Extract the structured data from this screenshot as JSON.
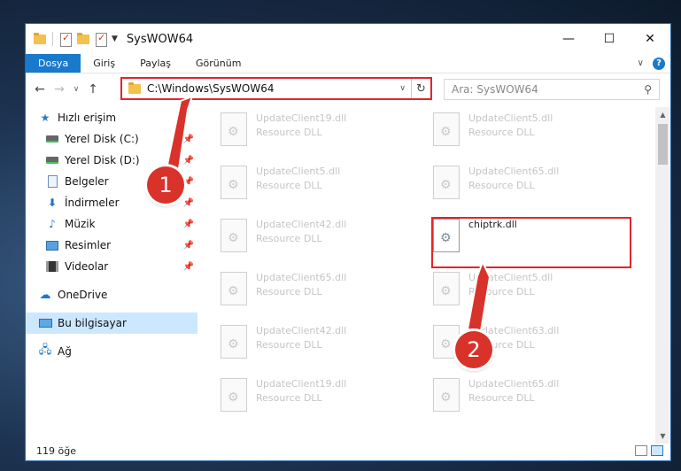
{
  "window": {
    "title": "SysWOW64",
    "controls": {
      "minimize": "—",
      "maximize": "☐",
      "close": "✕"
    }
  },
  "ribbon": {
    "tabs": [
      {
        "label": "Dosya",
        "active": true
      },
      {
        "label": "Giriş"
      },
      {
        "label": "Paylaş"
      },
      {
        "label": "Görünüm"
      }
    ],
    "help": "?"
  },
  "address": {
    "path": "C:\\Windows\\SysWOW64"
  },
  "search": {
    "placeholder": "Ara: SysWOW64"
  },
  "sidebar": {
    "quick_access": "Hızlı erişim",
    "items": [
      {
        "label": "Yerel Disk (C:)"
      },
      {
        "label": "Yerel Disk (D:)"
      },
      {
        "label": "Belgeler"
      },
      {
        "label": "İndirmeler"
      },
      {
        "label": "Müzik"
      },
      {
        "label": "Resimler"
      },
      {
        "label": "Videolar"
      }
    ],
    "onedrive": "OneDrive",
    "this_pc": "Bu bilgisayar",
    "network": "Ağ"
  },
  "files": [
    {
      "name": "UpdateClient19.dll",
      "type": "Resource DLL"
    },
    {
      "name": "UpdateClient5.dll",
      "type": "Resource DLL"
    },
    {
      "name": "UpdateClient5.dll",
      "type": "Resource DLL"
    },
    {
      "name": "UpdateClient65.dll",
      "type": "Resource DLL"
    },
    {
      "name": "UpdateClient42.dll",
      "type": "Resource DLL"
    },
    {
      "name": "chiptrk.dll",
      "type": ""
    },
    {
      "name": "UpdateClient65.dll",
      "type": "Resource DLL"
    },
    {
      "name": "UpdateClient5.dll",
      "type": "Resource DLL"
    },
    {
      "name": "UpdateClient42.dll",
      "type": "Resource DLL"
    },
    {
      "name": "UpdateClient63.dll",
      "type": "Resource DLL"
    },
    {
      "name": "UpdateClient19.dll",
      "type": "Resource DLL"
    },
    {
      "name": "UpdateClient65.dll",
      "type": "Resource DLL"
    }
  ],
  "status": {
    "count": "119 öğe"
  },
  "annotations": {
    "step1": "1",
    "step2": "2",
    "color": "#d8322b"
  }
}
